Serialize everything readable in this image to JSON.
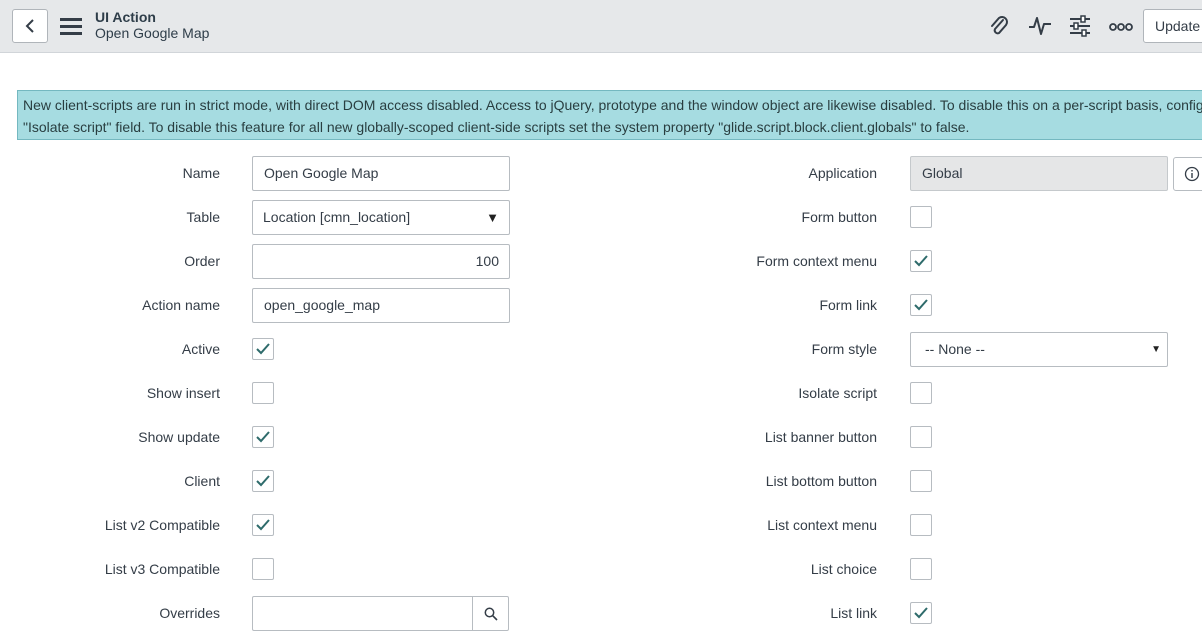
{
  "header": {
    "record_type": "UI Action",
    "record_name": "Open Google Map",
    "update_label": "Update",
    "icons": [
      "back-icon",
      "hamburger-menu-icon",
      "paperclip-icon",
      "activity-pulse-icon",
      "sliders-icon",
      "more-options-icon"
    ]
  },
  "banner": {
    "line1": "New client-scripts are run in strict mode, with direct DOM access disabled. Access to jQuery, prototype and the window object are likewise disabled. To disable this on a per-script basis, configure this form and add the",
    "line2": "\"Isolate script\" field. To disable this feature for all new globally-scoped client-side scripts set the system property \"glide.script.block.client.globals\" to false."
  },
  "form": {
    "name": {
      "label": "Name",
      "value": "Open Google Map"
    },
    "table": {
      "label": "Table",
      "value": "Location [cmn_location]"
    },
    "order": {
      "label": "Order",
      "value": "100"
    },
    "action_name": {
      "label": "Action name",
      "value": "open_google_map"
    },
    "active": {
      "label": "Active",
      "checked": true
    },
    "show_insert": {
      "label": "Show insert",
      "checked": false
    },
    "show_update": {
      "label": "Show update",
      "checked": true
    },
    "client": {
      "label": "Client",
      "checked": true
    },
    "list_v2": {
      "label": "List v2 Compatible",
      "checked": true
    },
    "list_v3": {
      "label": "List v3 Compatible",
      "checked": false
    },
    "overrides": {
      "label": "Overrides",
      "value": ""
    },
    "application": {
      "label": "Application",
      "value": "Global"
    },
    "form_button": {
      "label": "Form button",
      "checked": false
    },
    "form_context_menu": {
      "label": "Form context menu",
      "checked": true
    },
    "form_link": {
      "label": "Form link",
      "checked": true
    },
    "form_style": {
      "label": "Form style",
      "value": "-- None --"
    },
    "isolate_script": {
      "label": "Isolate script",
      "checked": false
    },
    "list_banner_button": {
      "label": "List banner button",
      "checked": false
    },
    "list_bottom_button": {
      "label": "List bottom button",
      "checked": false
    },
    "list_context_menu": {
      "label": "List context menu",
      "checked": false
    },
    "list_choice": {
      "label": "List choice",
      "checked": false
    },
    "list_link": {
      "label": "List link",
      "checked": true
    }
  },
  "colors": {
    "header_bg": "#e6e8ea",
    "banner_bg": "#a6dce1",
    "checkmark": "#2e6b6b"
  }
}
